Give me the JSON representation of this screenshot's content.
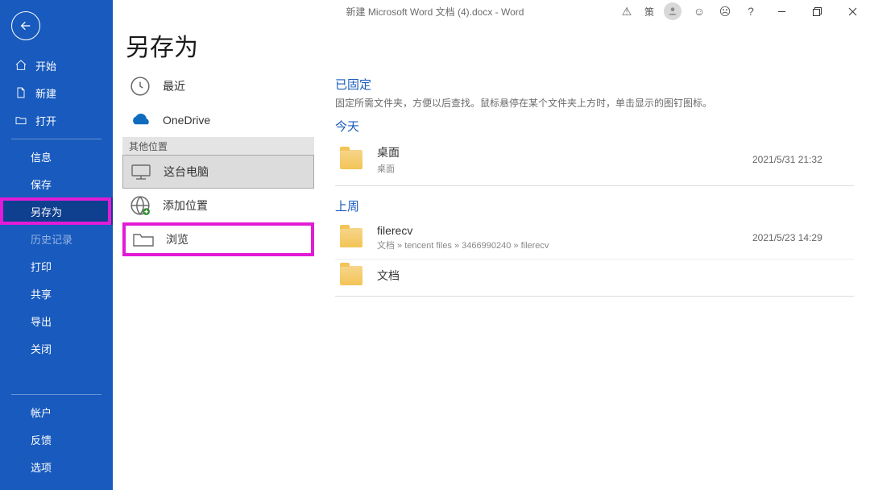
{
  "title": "新建 Microsoft Word 文档 (4).docx  -  Word",
  "titlebar": {
    "quick_char": "策"
  },
  "sidebar": {
    "home": "开始",
    "new": "新建",
    "open": "打开",
    "info": "信息",
    "save": "保存",
    "save_as": "另存为",
    "history": "历史记录",
    "print": "打印",
    "share": "共享",
    "export": "导出",
    "close": "关闭",
    "account": "帐户",
    "feedback": "反馈",
    "options": "选项"
  },
  "page": {
    "heading": "另存为"
  },
  "locations": {
    "recent": "最近",
    "onedrive": "OneDrive",
    "other_header": "其他位置",
    "this_pc": "这台电脑",
    "add_place": "添加位置",
    "browse": "浏览"
  },
  "right": {
    "pinned_title": "已固定",
    "pinned_desc": "固定所需文件夹，方便以后查找。鼠标悬停在某个文件夹上方时，单击显示的图钉图标。",
    "today_title": "今天",
    "lastweek_title": "上周",
    "folders": {
      "desktop": {
        "name": "桌面",
        "path": "桌面",
        "date": "2021/5/31 21:32"
      },
      "filerecv": {
        "name": "filerecv",
        "path": "文档 » tencent files » 3466990240 » filerecv",
        "date": "2021/5/23 14:29"
      },
      "docs": {
        "name": "文档",
        "path": "",
        "date": ""
      }
    }
  }
}
